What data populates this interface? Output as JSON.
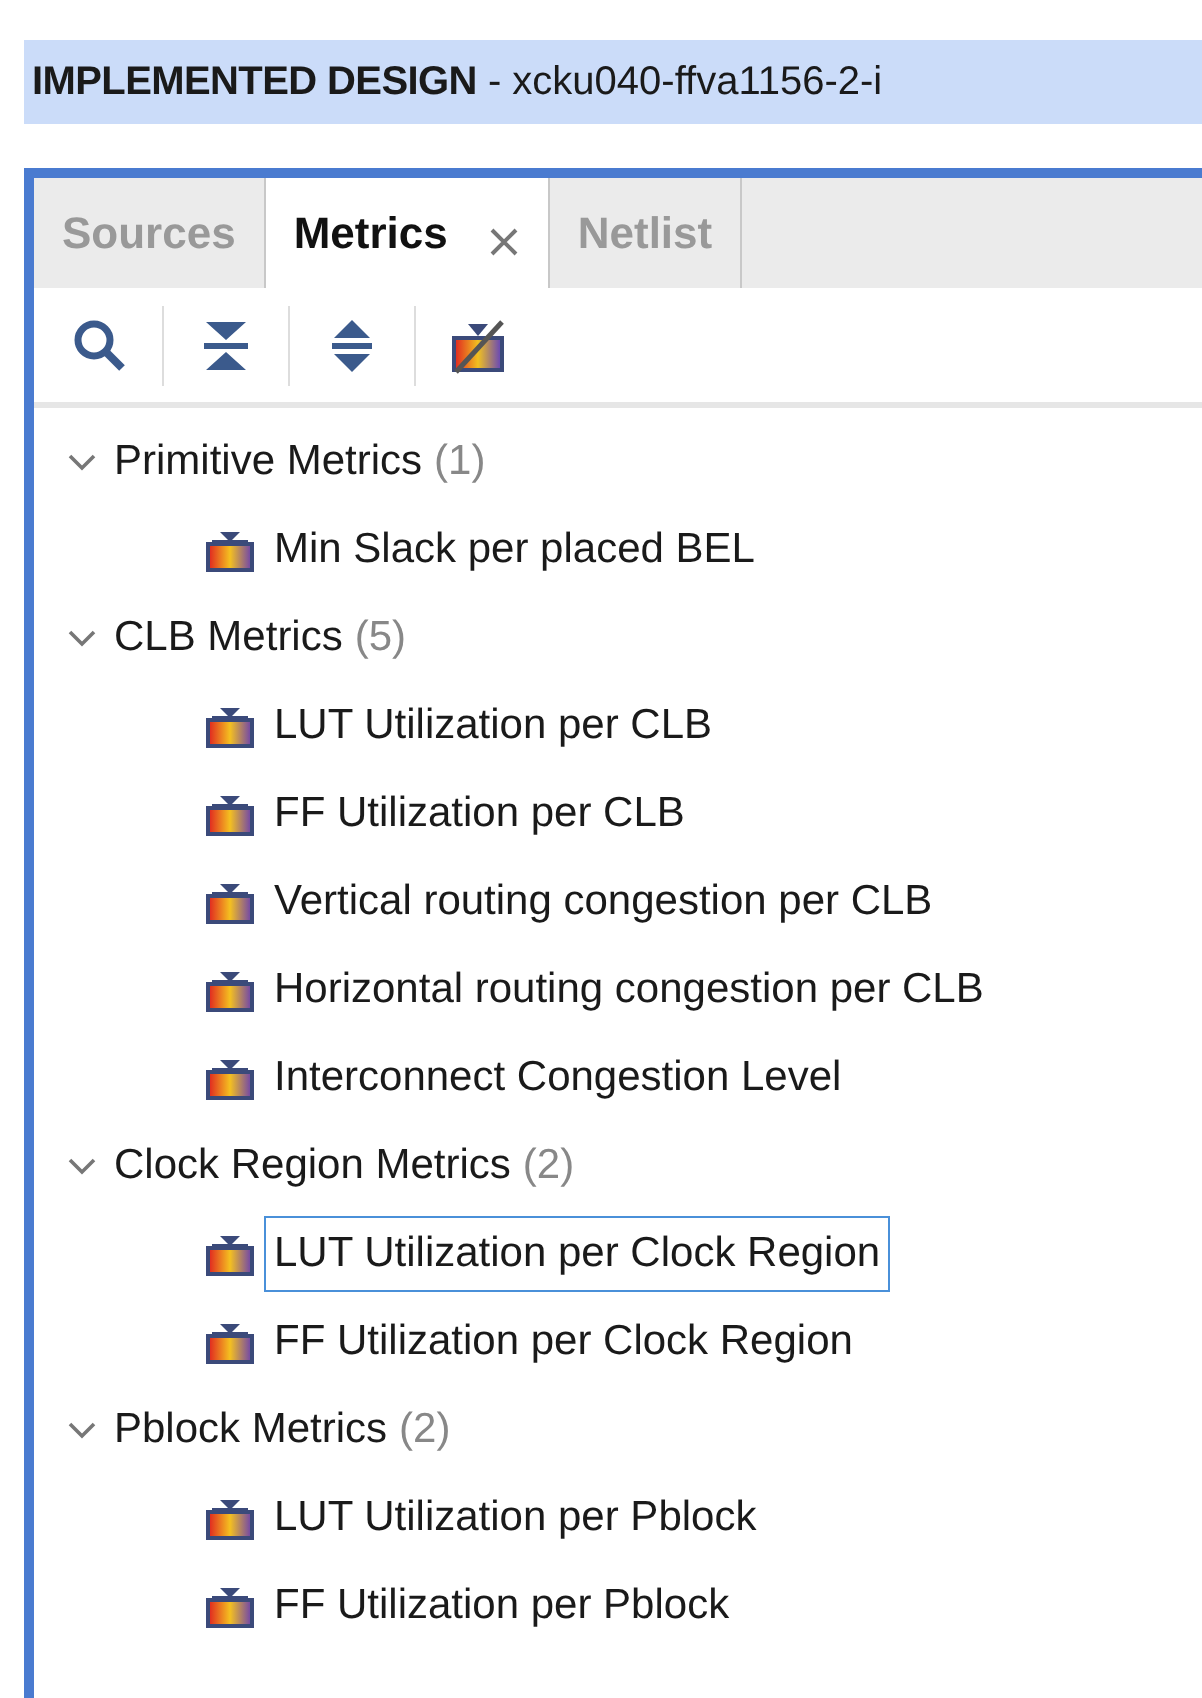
{
  "header": {
    "title": "IMPLEMENTED DESIGN",
    "subtitle": " - xcku040-ffva1156-2-i"
  },
  "tabs": [
    {
      "label": "Sources",
      "selected": false,
      "closable": false
    },
    {
      "label": "Metrics",
      "selected": true,
      "closable": true
    },
    {
      "label": "Netlist",
      "selected": false,
      "closable": false
    }
  ],
  "toolbar": [
    {
      "kind": "search"
    },
    {
      "kind": "collapse"
    },
    {
      "kind": "expand"
    },
    {
      "kind": "metric-off"
    }
  ],
  "tree": [
    {
      "label": "Primitive Metrics",
      "count": "(1)",
      "expanded": true,
      "children": [
        {
          "label": "Min Slack per placed BEL",
          "selected": false
        }
      ]
    },
    {
      "label": "CLB Metrics",
      "count": "(5)",
      "expanded": true,
      "children": [
        {
          "label": "LUT Utilization per CLB",
          "selected": false
        },
        {
          "label": "FF Utilization per CLB",
          "selected": false
        },
        {
          "label": "Vertical routing congestion per CLB",
          "selected": false
        },
        {
          "label": "Horizontal routing congestion per CLB",
          "selected": false
        },
        {
          "label": "Interconnect Congestion Level",
          "selected": false
        }
      ]
    },
    {
      "label": "Clock Region Metrics",
      "count": "(2)",
      "expanded": true,
      "children": [
        {
          "label": "LUT Utilization per Clock Region",
          "selected": true
        },
        {
          "label": "FF Utilization per Clock Region",
          "selected": false
        }
      ]
    },
    {
      "label": "Pblock Metrics",
      "count": "(2)",
      "expanded": true,
      "children": [
        {
          "label": "LUT Utilization per Pblock",
          "selected": false
        },
        {
          "label": "FF Utilization per Pblock",
          "selected": false
        }
      ]
    }
  ]
}
